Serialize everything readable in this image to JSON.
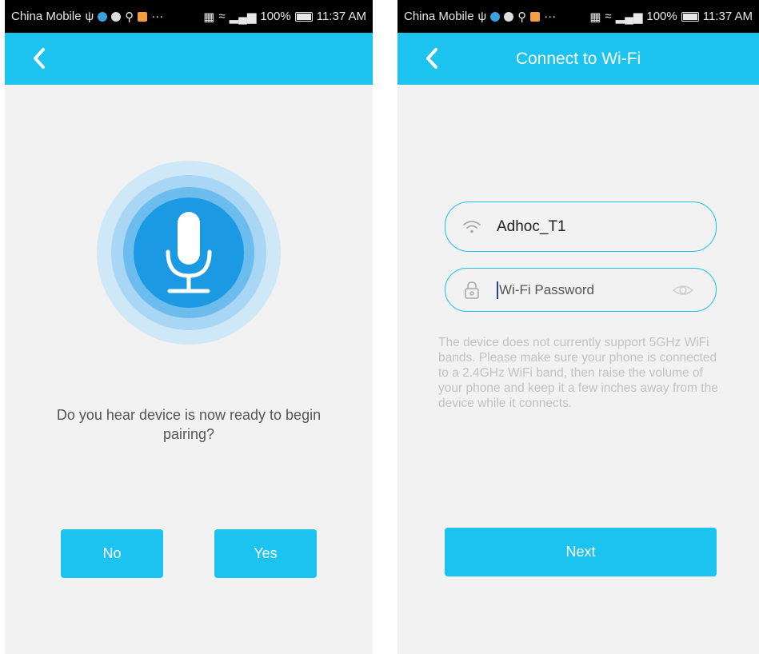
{
  "status_bar": {
    "carrier": "China Mobile",
    "signal": "⁴ᴳ",
    "battery": "100%",
    "time": "11:37 AM",
    "ellipsis": "···"
  },
  "left_screen": {
    "question": "Do you hear device is now ready to begin pairing?",
    "no_label": "No",
    "yes_label": "Yes"
  },
  "right_screen": {
    "title": "Connect to Wi-Fi",
    "ssid": "Adhoc_T1",
    "password_placeholder": "Wi-Fi Password",
    "note": "The device does not currently support 5GHz WiFi bands. Please make sure your phone is connected to a 2.4GHz WiFi band, then raise the volume of your phone and keep it a few inches away from the device while it connects.",
    "next_label": "Next"
  },
  "colors": {
    "accent": "#1dc3ef",
    "mic_core": "#1b9ae3",
    "background": "#f2f2f2"
  },
  "icons": [
    "back-chevron-icon",
    "microphone-icon",
    "wifi-icon",
    "lock-icon",
    "eye-icon"
  ]
}
